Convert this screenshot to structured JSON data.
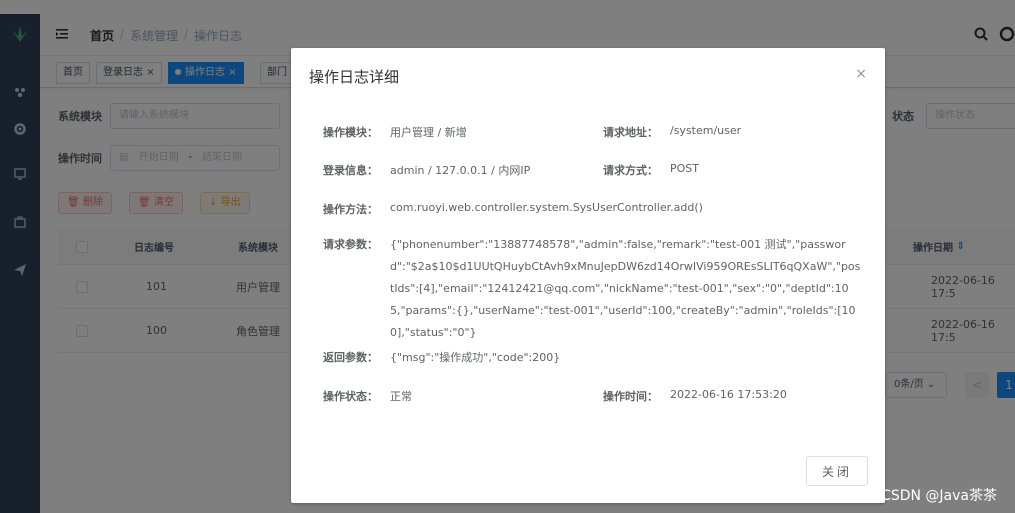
{
  "navbar": {
    "breadcrumb": [
      "首页",
      "系统管理",
      "操作日志"
    ],
    "separator": "/"
  },
  "tags": [
    {
      "label": "首页"
    },
    {
      "label": "登录日志",
      "close": "×"
    },
    {
      "label": "操作日志",
      "close": "×",
      "active": true
    },
    {
      "label": "部门"
    }
  ],
  "filters": {
    "module_label": "系统模块",
    "module_placeholder": "请输入系统模块",
    "status_label": "状态",
    "status_placeholder": "操作状态",
    "time_label": "操作时间",
    "start_placeholder": "开始日期",
    "range_sep": "-",
    "end_placeholder": "结束日期"
  },
  "toolbar": {
    "delete_label": "删除",
    "clear_label": "清空",
    "export_label": "导出"
  },
  "table": {
    "headers": {
      "id": "日志编号",
      "module": "系统模块",
      "date": "操作日期"
    },
    "rows": [
      {
        "id": "101",
        "module": "用户管理",
        "date": "2022-06-16 17:5"
      },
      {
        "id": "100",
        "module": "角色管理",
        "date": "2022-06-16 17:5"
      }
    ]
  },
  "pager": {
    "size": "0条/页",
    "prev": "<",
    "page": "1"
  },
  "dialog": {
    "title": "操作日志详细",
    "close_icon": "×",
    "fields": {
      "module_label": "操作模块：",
      "module_value": "用户管理 / 新增",
      "url_label": "请求地址：",
      "url_value": "/system/user",
      "login_label": "登录信息：",
      "login_value": "admin / 127.0.0.1 / 内网IP",
      "method_label": "请求方式：",
      "method_value": "POST",
      "func_label": "操作方法：",
      "func_value": "com.ruoyi.web.controller.system.SysUserController.add()",
      "param_label": "请求参数：",
      "param_value": "{\"phonenumber\":\"13887748578\",\"admin\":false,\"remark\":\"test-001 测试\",\"password\":\"$2a$10$d1UUtQHuybCtAvh9xMnuJepDW6zd14OrwIVi959OREsSLIT6qQXaW\",\"postIds\":[4],\"email\":\"12412421@qq.com\",\"nickName\":\"test-001\",\"sex\":\"0\",\"deptId\":105,\"params\":{},\"userName\":\"test-001\",\"userId\":100,\"createBy\":\"admin\",\"roleIds\":[100],\"status\":\"0\"}",
      "result_label": "返回参数：",
      "result_value": "{\"msg\":\"操作成功\",\"code\":200}",
      "status_label": "操作状态：",
      "status_value": "正常",
      "time_label": "操作时间：",
      "time_value": "2022-06-16 17:53:20"
    },
    "close_button": "关闭"
  },
  "watermark": "CSDN @Java茶茶",
  "colors": {
    "sidebar": "#304156",
    "primary": "#1890ff",
    "danger": "#f56c6c",
    "warning": "#e6a23c"
  }
}
